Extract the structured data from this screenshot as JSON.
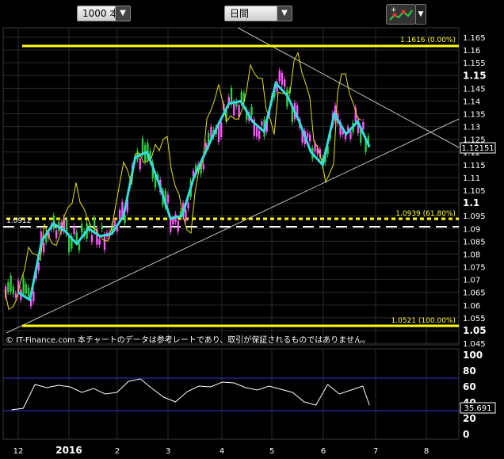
{
  "toolbar": {
    "bars_select": "1000 本",
    "period_select": "日間",
    "tool_icon": "chart-tool-icon"
  },
  "copyright": "© IT-Finance.com  本チャートのデータは参考レートであり、取引が保証されるものではありません。",
  "levels": {
    "high": "1.1616 (0.00%)",
    "fib618": "1.0939 (61.80%)",
    "low": "1.0521 (100.00%)",
    "support_left": "1.0912",
    "current_price": "1.12151",
    "rsi_value": "35.691"
  },
  "chart_data": [
    {
      "type": "candlestick",
      "instrument": "",
      "ylim": [
        1.045,
        1.167
      ],
      "y_ticks": [
        "1.165",
        "1.16",
        "1.155",
        "1.15",
        "1.145",
        "1.14",
        "1.135",
        "1.13",
        "1.125",
        "1.12",
        "1.115",
        "1.11",
        "1.105",
        "1.1",
        "1.095",
        "1.09",
        "1.085",
        "1.08",
        "1.075",
        "1.07",
        "1.065",
        "1.06",
        "1.055",
        "1.05",
        "1.045"
      ],
      "x_ticks": [
        "12",
        "2016",
        "2",
        "3",
        "4",
        "5",
        "6",
        "7",
        "8"
      ],
      "horizontal_lines": [
        {
          "value": 1.1616,
          "label": "1.1616 (0.00%)",
          "color": "#ffff00"
        },
        {
          "value": 1.0939,
          "label": "1.0939 (61.80%)",
          "color": "#ffff00",
          "style": "dashed"
        },
        {
          "value": 1.0912,
          "label": "1.0912",
          "color": "#ffffff",
          "style": "dashed"
        },
        {
          "value": 1.0521,
          "label": "1.0521 (100.00%)",
          "color": "#ffff00"
        }
      ],
      "trendlines": [
        "upper-triangle-line",
        "lower-triangle-line"
      ],
      "moving_average": [
        {
          "date": "2015-12-01",
          "value": 1.065
        },
        {
          "date": "2015-12-08",
          "value": 1.062
        },
        {
          "date": "2015-12-15",
          "value": 1.085
        },
        {
          "date": "2015-12-22",
          "value": 1.092
        },
        {
          "date": "2015-12-29",
          "value": 1.089
        },
        {
          "date": "2016-01-05",
          "value": 1.084
        },
        {
          "date": "2016-01-12",
          "value": 1.09
        },
        {
          "date": "2016-01-19",
          "value": 1.087
        },
        {
          "date": "2016-01-26",
          "value": 1.088
        },
        {
          "date": "2016-02-02",
          "value": 1.095
        },
        {
          "date": "2016-02-09",
          "value": 1.118
        },
        {
          "date": "2016-02-16",
          "value": 1.12
        },
        {
          "date": "2016-02-23",
          "value": 1.108
        },
        {
          "date": "2016-03-01",
          "value": 1.094
        },
        {
          "date": "2016-03-08",
          "value": 1.095
        },
        {
          "date": "2016-03-15",
          "value": 1.11
        },
        {
          "date": "2016-03-22",
          "value": 1.12
        },
        {
          "date": "2016-03-29",
          "value": 1.13
        },
        {
          "date": "2016-04-05",
          "value": 1.139
        },
        {
          "date": "2016-04-12",
          "value": 1.14
        },
        {
          "date": "2016-04-19",
          "value": 1.132
        },
        {
          "date": "2016-04-26",
          "value": 1.128
        },
        {
          "date": "2016-05-03",
          "value": 1.147
        },
        {
          "date": "2016-05-10",
          "value": 1.142
        },
        {
          "date": "2016-05-17",
          "value": 1.132
        },
        {
          "date": "2016-05-24",
          "value": 1.12
        },
        {
          "date": "2016-05-31",
          "value": 1.115
        },
        {
          "date": "2016-06-07",
          "value": 1.135
        },
        {
          "date": "2016-06-14",
          "value": 1.127
        },
        {
          "date": "2016-06-21",
          "value": 1.132
        },
        {
          "date": "2016-06-28",
          "value": 1.122
        }
      ],
      "current_price": 1.12151
    },
    {
      "type": "line",
      "indicator": "",
      "ylim": [
        0,
        100
      ],
      "y_ticks": [
        "100",
        "80",
        "60",
        "40",
        "20",
        "0"
      ],
      "reference_lines": [
        70,
        30
      ],
      "series": [
        {
          "x": "2015-11-27",
          "y": 30
        },
        {
          "x": "2015-12-04",
          "y": 32
        },
        {
          "x": "2015-12-11",
          "y": 62
        },
        {
          "x": "2015-12-18",
          "y": 58
        },
        {
          "x": "2015-12-25",
          "y": 61
        },
        {
          "x": "2016-01-01",
          "y": 59
        },
        {
          "x": "2016-01-08",
          "y": 52
        },
        {
          "x": "2016-01-15",
          "y": 57
        },
        {
          "x": "2016-01-22",
          "y": 50
        },
        {
          "x": "2016-01-29",
          "y": 52
        },
        {
          "x": "2016-02-05",
          "y": 66
        },
        {
          "x": "2016-02-12",
          "y": 69
        },
        {
          "x": "2016-02-19",
          "y": 57
        },
        {
          "x": "2016-02-26",
          "y": 46
        },
        {
          "x": "2016-03-04",
          "y": 40
        },
        {
          "x": "2016-03-11",
          "y": 53
        },
        {
          "x": "2016-03-18",
          "y": 60
        },
        {
          "x": "2016-03-25",
          "y": 59
        },
        {
          "x": "2016-04-01",
          "y": 65
        },
        {
          "x": "2016-04-08",
          "y": 64
        },
        {
          "x": "2016-04-15",
          "y": 58
        },
        {
          "x": "2016-04-22",
          "y": 55
        },
        {
          "x": "2016-04-29",
          "y": 60
        },
        {
          "x": "2016-05-06",
          "y": 56
        },
        {
          "x": "2016-05-13",
          "y": 52
        },
        {
          "x": "2016-05-20",
          "y": 40
        },
        {
          "x": "2016-05-27",
          "y": 36
        },
        {
          "x": "2016-06-03",
          "y": 62
        },
        {
          "x": "2016-06-10",
          "y": 50
        },
        {
          "x": "2016-06-17",
          "y": 55
        },
        {
          "x": "2016-06-24",
          "y": 60
        },
        {
          "x": "2016-06-28",
          "y": 35.691
        }
      ]
    }
  ]
}
